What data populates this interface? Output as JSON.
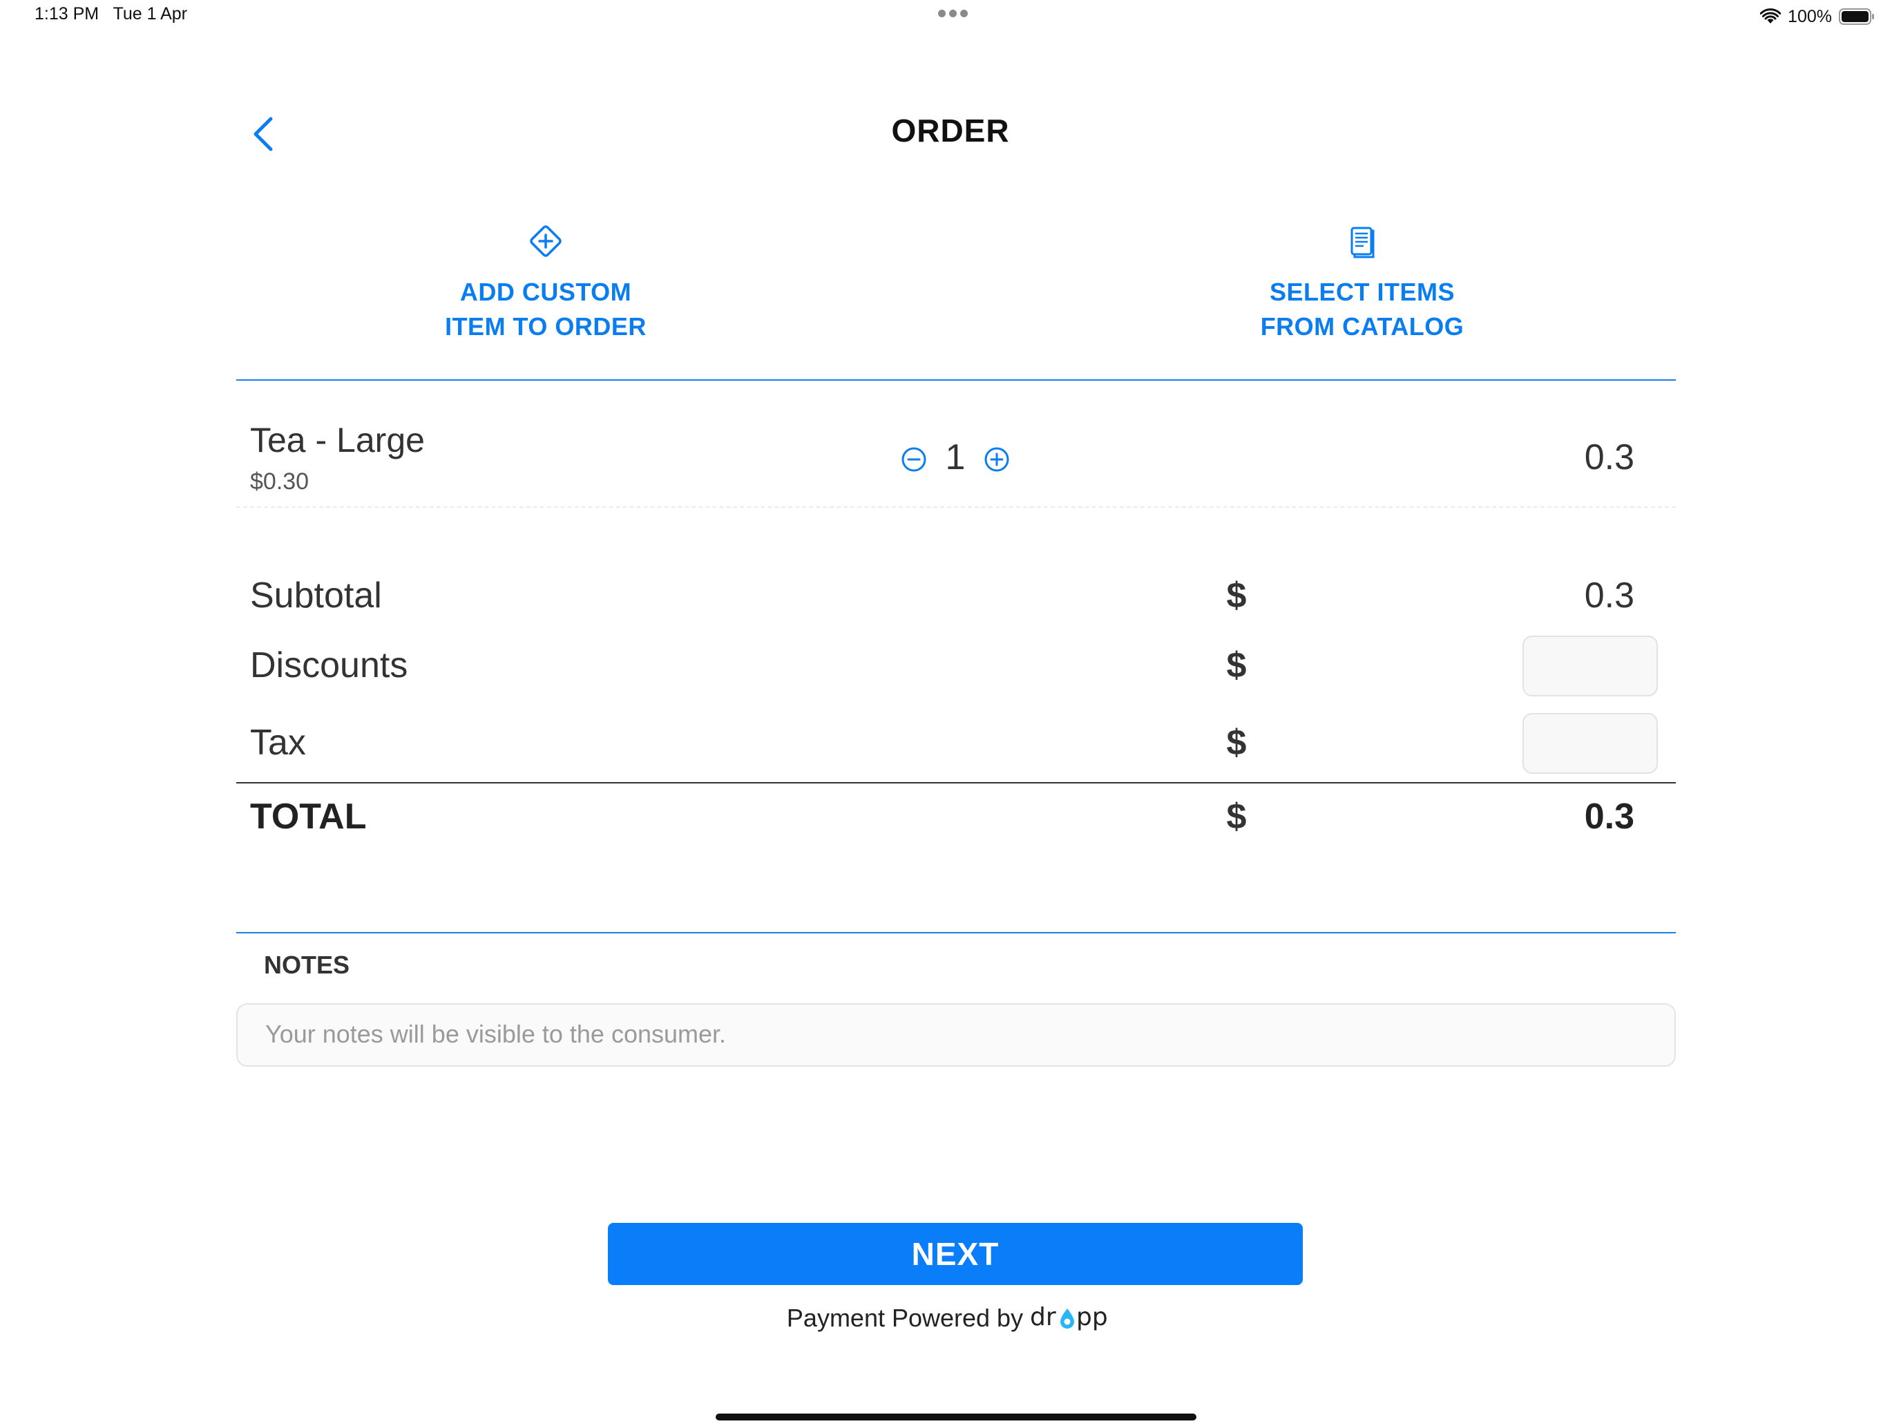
{
  "status_bar": {
    "time": "1:13 PM",
    "date": "Tue 1 Apr",
    "battery": "100%"
  },
  "header": {
    "title": "ORDER",
    "back_icon": "chevron-left-icon"
  },
  "actions": [
    {
      "line1": "ADD CUSTOM",
      "line2": "ITEM TO ORDER",
      "icon": "plus-diamond-icon"
    },
    {
      "line1": "SELECT ITEMS",
      "line2": "FROM CATALOG",
      "icon": "catalog-document-icon"
    }
  ],
  "line_items": [
    {
      "name": "Tea - Large",
      "unit_price": "$0.30",
      "quantity": "1",
      "total": "0.3"
    }
  ],
  "summary": {
    "subtotal": {
      "label": "Subtotal",
      "currency": "$",
      "value": "0.3"
    },
    "discounts": {
      "label": "Discounts",
      "currency": "$",
      "value": ""
    },
    "tax": {
      "label": "Tax",
      "currency": "$",
      "value": ""
    },
    "total": {
      "label": "TOTAL",
      "currency": "$",
      "value": "0.3"
    }
  },
  "notes": {
    "label": "NOTES",
    "placeholder": "Your notes will be visible to the consumer."
  },
  "footer": {
    "next_label": "NEXT",
    "powered_text": "Payment Powered by",
    "brand": "dropp"
  },
  "colors": {
    "accent": "#0a7ef0",
    "button": "#0a7ef8",
    "brand_drop": "#29b6f6"
  }
}
